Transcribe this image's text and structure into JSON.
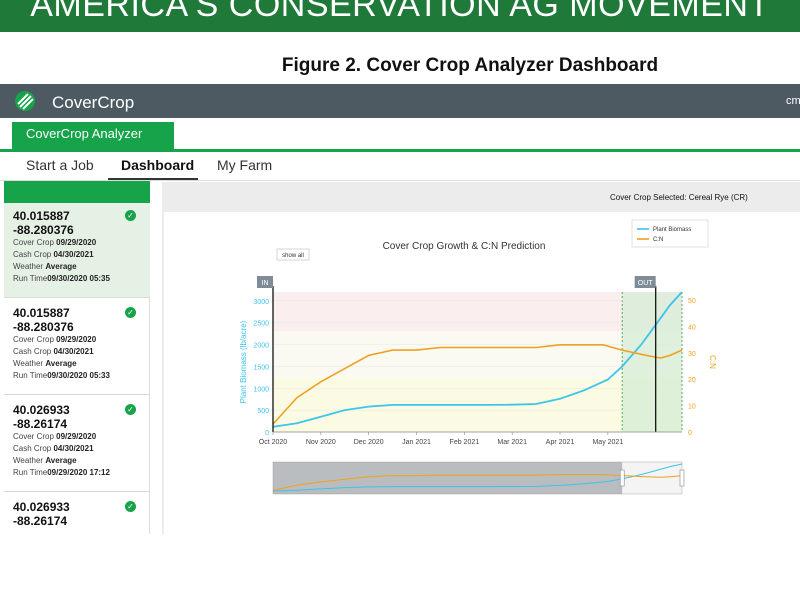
{
  "banner": {
    "text": "AMERICA'S CONSERVATION AG MOVEMENT"
  },
  "figure": {
    "title": "Figure 2. Cover Crop Analyzer Dashboard"
  },
  "app": {
    "name": "CoverCrop",
    "user": "cm",
    "logo_icon": "covercrop-logo-icon"
  },
  "analyzer_tab": {
    "label": "CoverCrop Analyzer"
  },
  "nav": {
    "tabs": [
      {
        "label": "Start a Job"
      },
      {
        "label": "Dashboard",
        "active": true
      },
      {
        "label": "My Farm"
      }
    ]
  },
  "jobs": [
    {
      "lat": "40.015887",
      "lon": "-88.280376",
      "cover_crop_label": "Cover Crop",
      "cover_crop": "09/29/2020",
      "cash_crop_label": "Cash Crop",
      "cash_crop": "04/30/2021",
      "weather_label": "Weather",
      "weather": "Average",
      "run_time_label": "Run Time",
      "run_time": "09/30/2020 05:35",
      "selected": true
    },
    {
      "lat": "40.015887",
      "lon": "-88.280376",
      "cover_crop_label": "Cover Crop",
      "cover_crop": "09/29/2020",
      "cash_crop_label": "Cash Crop",
      "cash_crop": "04/30/2021",
      "weather_label": "Weather",
      "weather": "Average",
      "run_time_label": "Run Time",
      "run_time": "09/30/2020 05:33"
    },
    {
      "lat": "40.026933",
      "lon": "-88.26174",
      "cover_crop_label": "Cover Crop",
      "cover_crop": "09/29/2020",
      "cash_crop_label": "Cash Crop",
      "cash_crop": "04/30/2021",
      "weather_label": "Weather",
      "weather": "Average",
      "run_time_label": "Run Time",
      "run_time": "09/29/2020 17:12"
    },
    {
      "lat": "40.026933",
      "lon": "-88.26174"
    }
  ],
  "dashboard": {
    "selected_crop": "Cover Crop Selected: Cereal Rye (CR)"
  },
  "chart_data": {
    "type": "line",
    "title": "Cover Crop Growth & C:N Prediction",
    "show_all_label": "show all",
    "in_label": "IN",
    "out_label": "OUT",
    "ylabel": "Plant Biomass (lb/acre)",
    "y2label": "C:N",
    "ylim": [
      0,
      3200
    ],
    "y2lim": [
      0,
      53
    ],
    "yticks": [
      0,
      500,
      1000,
      1500,
      2000,
      2500,
      3000
    ],
    "y2ticks": [
      0,
      10,
      20,
      30,
      40,
      50
    ],
    "xticks": [
      "Oct 2020",
      "Nov 2020",
      "Dec 2020",
      "Jan 2021",
      "Feb 2021",
      "Mar 2021",
      "Apr 2021",
      "May 2021"
    ],
    "legend_position": "top-right",
    "colors": {
      "biomass": "#3ec3ea",
      "cn": "#f0a020"
    },
    "series": [
      {
        "name": "Plant Biomass",
        "axis": "left",
        "x": [
          0,
          0.2,
          0.5,
          1.0,
          1.5,
          2.0,
          2.5,
          3.0,
          3.5,
          4.0,
          4.5,
          5.0,
          5.5,
          6.0,
          6.5,
          7.0,
          7.3,
          7.7,
          8.0,
          8.3,
          8.55
        ],
        "values": [
          120,
          150,
          200,
          350,
          500,
          580,
          620,
          620,
          620,
          620,
          620,
          625,
          640,
          760,
          950,
          1200,
          1500,
          2000,
          2450,
          2900,
          3200
        ]
      },
      {
        "name": "C:N",
        "axis": "right",
        "x": [
          0,
          0.2,
          0.5,
          1.0,
          1.5,
          2.0,
          2.5,
          3.0,
          3.5,
          4.0,
          4.5,
          5.0,
          5.5,
          6.0,
          6.5,
          6.9,
          7.3,
          7.8,
          8.1,
          8.3,
          8.55
        ],
        "values": [
          3,
          7,
          13,
          19,
          24,
          29,
          31,
          31,
          32,
          32,
          32,
          32,
          32,
          33,
          33,
          33,
          31,
          29,
          28,
          29,
          31
        ]
      }
    ],
    "in_x": 0,
    "out_x": 8.0,
    "shaded_window": [
      7.3,
      8.55
    ],
    "bands": [
      {
        "from": 0,
        "to": 1250,
        "color": "#fbfbe4"
      },
      {
        "from": 1250,
        "to": 2300,
        "color": "#fafaf3"
      },
      {
        "from": 2300,
        "to": 3200,
        "color": "#fbeeee"
      }
    ]
  }
}
